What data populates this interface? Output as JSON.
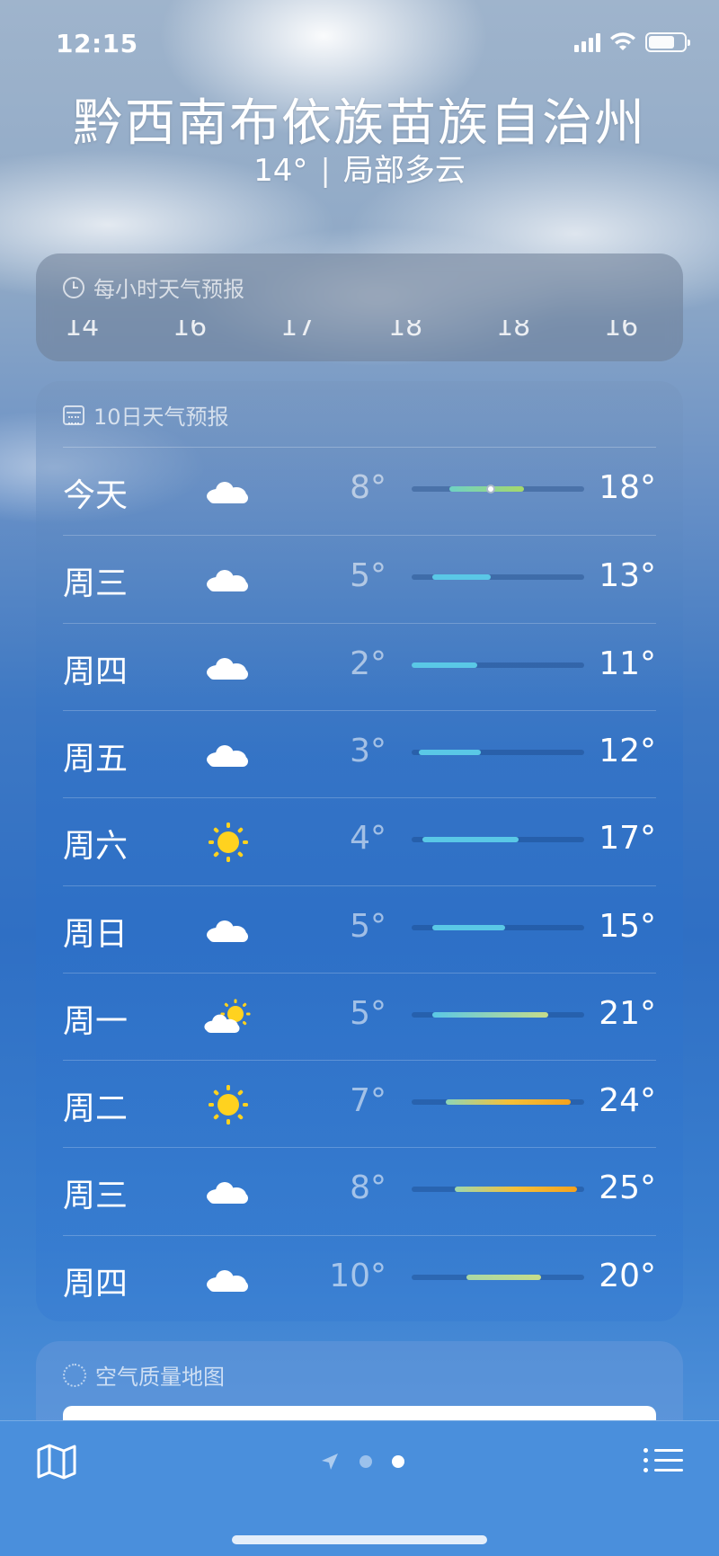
{
  "status": {
    "time": "12:15"
  },
  "header": {
    "city": "黔西南布依族苗族自治州",
    "temp": "14°",
    "separator": "|",
    "condition": "局部多云"
  },
  "hourly": {
    "title": "每小时天气预报",
    "hours": [
      "14",
      "16",
      "17",
      "18",
      "18",
      "16"
    ]
  },
  "daily": {
    "title": "10日天气预报",
    "days": [
      {
        "day": "今天",
        "icon": "cloud-icon",
        "low": "8°",
        "high": "18°",
        "range_start_pct": 22,
        "range_end_pct": 65,
        "current_pct": 46,
        "color": "linear-gradient(90deg,#6fd2c4,#a6d86a)"
      },
      {
        "day": "周三",
        "icon": "cloud-icon",
        "low": "5°",
        "high": "13°",
        "range_start_pct": 12,
        "range_end_pct": 46,
        "color": "#5ac8e6"
      },
      {
        "day": "周四",
        "icon": "cloud-icon",
        "low": "2°",
        "high": "11°",
        "range_start_pct": 0,
        "range_end_pct": 38,
        "color": "#5ac8e6"
      },
      {
        "day": "周五",
        "icon": "cloud-icon",
        "low": "3°",
        "high": "12°",
        "range_start_pct": 4,
        "range_end_pct": 40,
        "color": "#5ac8e6"
      },
      {
        "day": "周六",
        "icon": "sun-icon",
        "low": "4°",
        "high": "17°",
        "range_start_pct": 6,
        "range_end_pct": 62,
        "color": "#5ac8e6"
      },
      {
        "day": "周日",
        "icon": "cloud-icon",
        "low": "5°",
        "high": "15°",
        "range_start_pct": 12,
        "range_end_pct": 54,
        "color": "#5ac8e6"
      },
      {
        "day": "周一",
        "icon": "partly-sunny-icon",
        "low": "5°",
        "high": "21°",
        "range_start_pct": 12,
        "range_end_pct": 79,
        "color": "linear-gradient(90deg,#5ac8e6,#c6dc8a)"
      },
      {
        "day": "周二",
        "icon": "sun-icon",
        "low": "7°",
        "high": "24°",
        "range_start_pct": 20,
        "range_end_pct": 92,
        "color": "linear-gradient(90deg,#8dd6b8,#f4c03a,#f4a21e)"
      },
      {
        "day": "周三",
        "icon": "cloud-icon",
        "low": "8°",
        "high": "25°",
        "range_start_pct": 25,
        "range_end_pct": 96,
        "color": "linear-gradient(90deg,#9ed8ae,#f4c03a,#f4a21e)"
      },
      {
        "day": "周四",
        "icon": "cloud-icon",
        "low": "10°",
        "high": "20°",
        "range_start_pct": 32,
        "range_end_pct": 75,
        "color": "linear-gradient(90deg,#a9d8a6,#c6dc8a)"
      }
    ]
  },
  "air_quality": {
    "title": "空气质量地图"
  }
}
